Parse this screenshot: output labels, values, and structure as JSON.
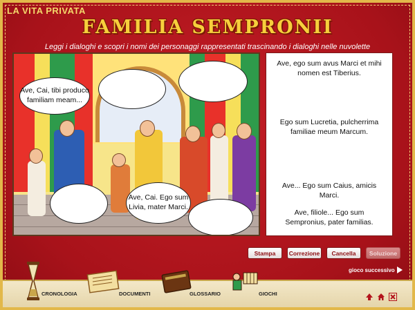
{
  "header": {
    "section_title": "LA VITA PRIVATA",
    "main_title": "FAMILIA SEMPRONII",
    "instructions": "Leggi i dialoghi e scopri i nomi dei personaggi rappresentati trascinando i dialoghi nelle nuvolette"
  },
  "scene": {
    "bubbles": [
      {
        "id": "b1",
        "text": "Ave, Cai, tibi produco familiam meam..."
      },
      {
        "id": "b2",
        "text": ""
      },
      {
        "id": "b3",
        "text": ""
      },
      {
        "id": "b4",
        "text": ""
      },
      {
        "id": "b5",
        "text": "Ave, Cai. Ego sum Livia, mater Marci."
      },
      {
        "id": "b6",
        "text": ""
      }
    ]
  },
  "dialogs": [
    "Ave, ego sum avus Marci et mihi nomen est Tiberius.",
    "Ego sum Lucretia, pulcherrima familiae meum Marcum.",
    "Ave... Ego sum Caius, amicis Marci.",
    "Ave, filiole... Ego sum Sempronius, pater familias."
  ],
  "buttons": {
    "stampa": "Stampa",
    "correzione": "Correzione",
    "cancella": "Cancella",
    "soluzione": "Soluzione"
  },
  "next_link": "gioco successivo",
  "bottom_nav": [
    {
      "label": "CRONOLOGIA",
      "icon": "hourglass-icon"
    },
    {
      "label": "DOCUMENTI",
      "icon": "scroll-icon"
    },
    {
      "label": "GLOSSARIO",
      "icon": "book-icon"
    },
    {
      "label": "GIOCHI",
      "icon": "games-icon"
    }
  ],
  "colors": {
    "background": "#b3141c",
    "gold": "#f7cf3c",
    "button_text": "#8b0c10"
  }
}
